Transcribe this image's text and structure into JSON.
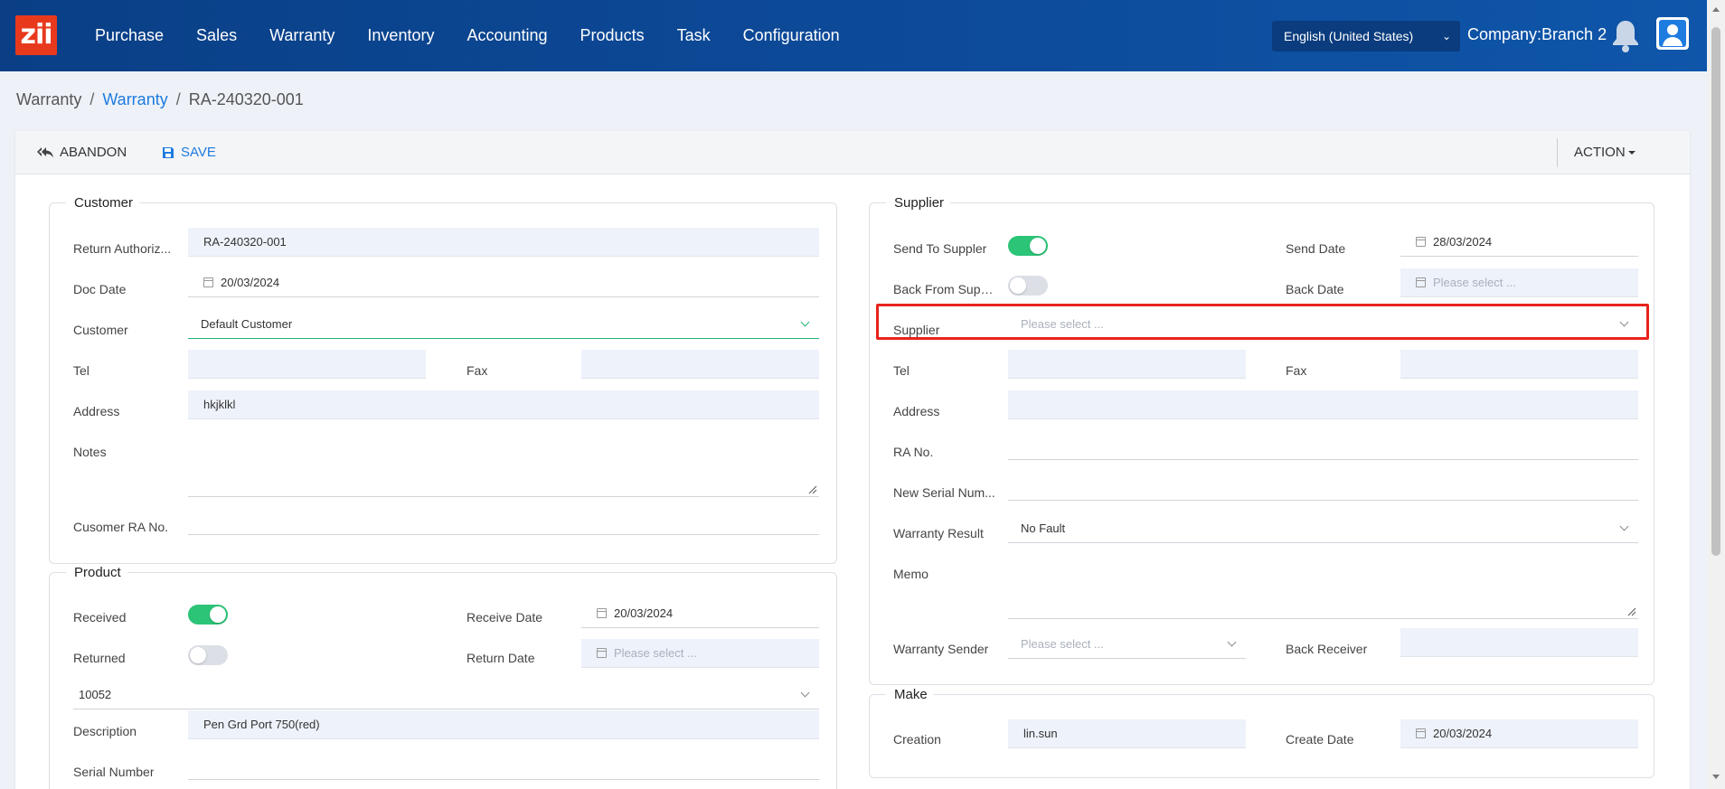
{
  "app": {
    "logo_text": "zii",
    "brand_color": "#e8391d",
    "nav_bg": "#0d4c9c"
  },
  "nav": [
    "Purchase",
    "Sales",
    "Warranty",
    "Inventory",
    "Accounting",
    "Products",
    "Task",
    "Configuration"
  ],
  "header": {
    "language": "English (United States)",
    "company": "Company:Branch 2"
  },
  "breadcrumb": {
    "root": "Warranty",
    "section": "Warranty",
    "current": "RA-240320-001"
  },
  "toolbar": {
    "abandon": "ABANDON",
    "save": "SAVE",
    "action": "ACTION"
  },
  "customer": {
    "title": "Customer",
    "return_auth_label": "Return Authoriz...",
    "return_auth_value": "RA-240320-001",
    "doc_date_label": "Doc Date",
    "doc_date_value": "20/03/2024",
    "customer_label": "Customer",
    "customer_value": "Default Customer",
    "tel_label": "Tel",
    "tel_value": "",
    "fax_label": "Fax",
    "fax_value": "",
    "address_label": "Address",
    "address_value": "hkjklkl",
    "notes_label": "Notes",
    "notes_value": "",
    "cus_ra_label": "Cusomer RA No.",
    "cus_ra_value": ""
  },
  "product": {
    "title": "Product",
    "received_label": "Received",
    "received_on": true,
    "receive_date_label": "Receive Date",
    "receive_date_value": "20/03/2024",
    "returned_label": "Returned",
    "returned_on": false,
    "return_date_label": "Return Date",
    "return_date_placeholder": "Please select ...",
    "product_code": "10052",
    "description_label": "Description",
    "description_value": "Pen Grd Port 750(red)",
    "serial_label": "Serial Number",
    "serial_value": ""
  },
  "supplier": {
    "title": "Supplier",
    "send_label": "Send To Suppler",
    "send_on": true,
    "send_date_label": "Send Date",
    "send_date_value": "28/03/2024",
    "back_from_label": "Back From Supp...",
    "back_from_on": false,
    "back_date_label": "Back Date",
    "back_date_placeholder": "Please select ...",
    "supplier_label": "Supplier",
    "supplier_placeholder": "Please select ...",
    "tel_label": "Tel",
    "fax_label": "Fax",
    "address_label": "Address",
    "ra_label": "RA No.",
    "new_serial_label": "New Serial Num...",
    "warranty_result_label": "Warranty Result",
    "warranty_result_value": "No Fault",
    "memo_label": "Memo",
    "sender_label": "Warranty Sender",
    "sender_placeholder": "Please select ...",
    "back_receiver_label": "Back Receiver"
  },
  "make": {
    "title": "Make",
    "creation_label": "Creation",
    "creation_value": "lin.sun",
    "create_date_label": "Create Date",
    "create_date_value": "20/03/2024"
  }
}
